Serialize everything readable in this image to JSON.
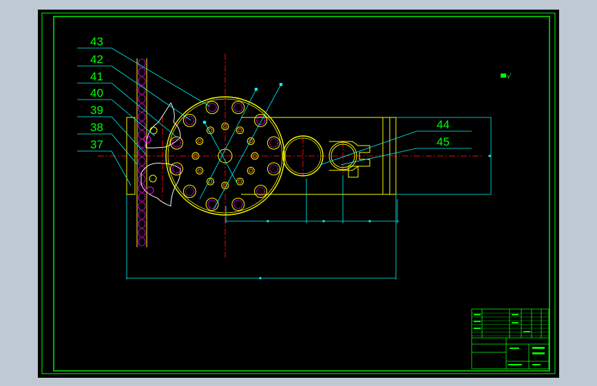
{
  "viewport": {
    "background": "#bfc9d3"
  },
  "drawing": {
    "background": "#000000",
    "frame_color": "#00ff00",
    "part_label_color": "#00ff00",
    "leader_color": "#00ffff",
    "centerline_color": "#ff0000",
    "part_color": "#ffff00",
    "hole_color": "#ff7f00",
    "roller_color": "#ff00ff",
    "dimension_color": "#00ffff"
  },
  "part_labels": [
    {
      "id": "43",
      "text": "43"
    },
    {
      "id": "42",
      "text": "42"
    },
    {
      "id": "41",
      "text": "41"
    },
    {
      "id": "40",
      "text": "40"
    },
    {
      "id": "39",
      "text": "39"
    },
    {
      "id": "38",
      "text": "38"
    },
    {
      "id": "37",
      "text": "37"
    },
    {
      "id": "44",
      "text": "44"
    },
    {
      "id": "45",
      "text": "45"
    }
  ],
  "annotations": {
    "roughness_symbol": "√"
  },
  "icons": {
    "roughness": "surface-roughness-icon"
  }
}
